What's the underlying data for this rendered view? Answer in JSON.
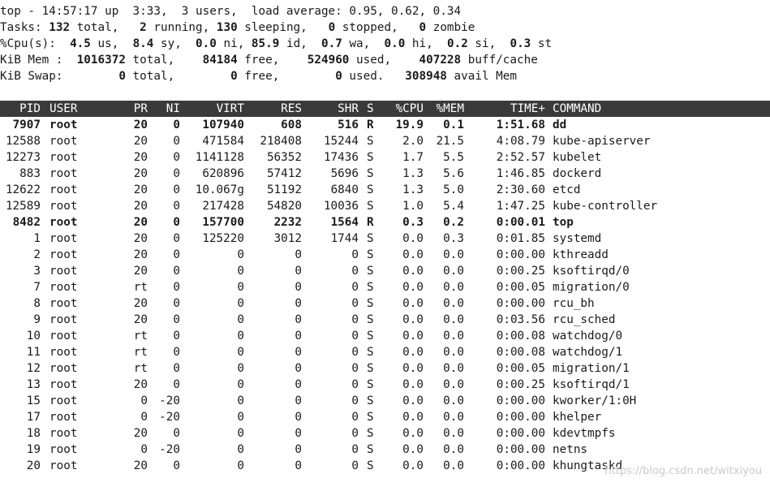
{
  "header": {
    "line1": [
      {
        "t": "top - 14:57:17 up  3:33,  3 users,  load average: 0.95, 0.62, 0.34",
        "b": false
      }
    ],
    "line2": [
      {
        "t": "Tasks: ",
        "b": false
      },
      {
        "t": "132",
        "b": true
      },
      {
        "t": " total,   ",
        "b": false
      },
      {
        "t": "2",
        "b": true
      },
      {
        "t": " running, ",
        "b": false
      },
      {
        "t": "130",
        "b": true
      },
      {
        "t": " sleeping,   ",
        "b": false
      },
      {
        "t": "0",
        "b": true
      },
      {
        "t": " stopped,   ",
        "b": false
      },
      {
        "t": "0",
        "b": true
      },
      {
        "t": " zombie",
        "b": false
      }
    ],
    "line3": [
      {
        "t": "%Cpu(s):  ",
        "b": false
      },
      {
        "t": "4.5",
        "b": true
      },
      {
        "t": " us,  ",
        "b": false
      },
      {
        "t": "8.4",
        "b": true
      },
      {
        "t": " sy,  ",
        "b": false
      },
      {
        "t": "0.0",
        "b": true
      },
      {
        "t": " ni, ",
        "b": false
      },
      {
        "t": "85.9",
        "b": true
      },
      {
        "t": " id,  ",
        "b": false
      },
      {
        "t": "0.7",
        "b": true
      },
      {
        "t": " wa,  ",
        "b": false
      },
      {
        "t": "0.0",
        "b": true
      },
      {
        "t": " hi,  ",
        "b": false
      },
      {
        "t": "0.2",
        "b": true
      },
      {
        "t": " si,  ",
        "b": false
      },
      {
        "t": "0.3",
        "b": true
      },
      {
        "t": " st",
        "b": false
      }
    ],
    "line4": [
      {
        "t": "KiB Mem :  ",
        "b": false
      },
      {
        "t": "1016372",
        "b": true
      },
      {
        "t": " total,    ",
        "b": false
      },
      {
        "t": "84184",
        "b": true
      },
      {
        "t": " free,    ",
        "b": false
      },
      {
        "t": "524960",
        "b": true
      },
      {
        "t": " used,    ",
        "b": false
      },
      {
        "t": "407228",
        "b": true
      },
      {
        "t": " buff/cache",
        "b": false
      }
    ],
    "line5": [
      {
        "t": "KiB Swap:        ",
        "b": false
      },
      {
        "t": "0",
        "b": true
      },
      {
        "t": " total,        ",
        "b": false
      },
      {
        "t": "0",
        "b": true
      },
      {
        "t": " free,        ",
        "b": false
      },
      {
        "t": "0",
        "b": true
      },
      {
        "t": " used.   ",
        "b": false
      },
      {
        "t": "308948",
        "b": true
      },
      {
        "t": " avail Mem",
        "b": false
      }
    ]
  },
  "columns": {
    "pid": "PID",
    "user": "USER",
    "pr": "PR",
    "ni": "NI",
    "virt": "VIRT",
    "res": "RES",
    "shr": "SHR",
    "s": "S",
    "cpu": "%CPU",
    "mem": "%MEM",
    "time": "TIME+",
    "cmd": "COMMAND"
  },
  "processes": [
    {
      "pid": "7907",
      "user": "root",
      "pr": "20",
      "ni": "0",
      "virt": "107940",
      "res": "608",
      "shr": "516",
      "s": "R",
      "cpu": "19.9",
      "mem": "0.1",
      "time": "1:51.68",
      "cmd": "dd",
      "running": true
    },
    {
      "pid": "12588",
      "user": "root",
      "pr": "20",
      "ni": "0",
      "virt": "471584",
      "res": "218408",
      "shr": "15244",
      "s": "S",
      "cpu": "2.0",
      "mem": "21.5",
      "time": "4:08.79",
      "cmd": "kube-apiserver",
      "running": false
    },
    {
      "pid": "12273",
      "user": "root",
      "pr": "20",
      "ni": "0",
      "virt": "1141128",
      "res": "56352",
      "shr": "17436",
      "s": "S",
      "cpu": "1.7",
      "mem": "5.5",
      "time": "2:52.57",
      "cmd": "kubelet",
      "running": false
    },
    {
      "pid": "883",
      "user": "root",
      "pr": "20",
      "ni": "0",
      "virt": "620896",
      "res": "57412",
      "shr": "5696",
      "s": "S",
      "cpu": "1.3",
      "mem": "5.6",
      "time": "1:46.85",
      "cmd": "dockerd",
      "running": false
    },
    {
      "pid": "12622",
      "user": "root",
      "pr": "20",
      "ni": "0",
      "virt": "10.067g",
      "res": "51192",
      "shr": "6840",
      "s": "S",
      "cpu": "1.3",
      "mem": "5.0",
      "time": "2:30.60",
      "cmd": "etcd",
      "running": false
    },
    {
      "pid": "12589",
      "user": "root",
      "pr": "20",
      "ni": "0",
      "virt": "217428",
      "res": "54820",
      "shr": "10036",
      "s": "S",
      "cpu": "1.0",
      "mem": "5.4",
      "time": "1:47.25",
      "cmd": "kube-controller",
      "running": false
    },
    {
      "pid": "8482",
      "user": "root",
      "pr": "20",
      "ni": "0",
      "virt": "157700",
      "res": "2232",
      "shr": "1564",
      "s": "R",
      "cpu": "0.3",
      "mem": "0.2",
      "time": "0:00.01",
      "cmd": "top",
      "running": true
    },
    {
      "pid": "1",
      "user": "root",
      "pr": "20",
      "ni": "0",
      "virt": "125220",
      "res": "3012",
      "shr": "1744",
      "s": "S",
      "cpu": "0.0",
      "mem": "0.3",
      "time": "0:01.85",
      "cmd": "systemd",
      "running": false
    },
    {
      "pid": "2",
      "user": "root",
      "pr": "20",
      "ni": "0",
      "virt": "0",
      "res": "0",
      "shr": "0",
      "s": "S",
      "cpu": "0.0",
      "mem": "0.0",
      "time": "0:00.00",
      "cmd": "kthreadd",
      "running": false
    },
    {
      "pid": "3",
      "user": "root",
      "pr": "20",
      "ni": "0",
      "virt": "0",
      "res": "0",
      "shr": "0",
      "s": "S",
      "cpu": "0.0",
      "mem": "0.0",
      "time": "0:00.25",
      "cmd": "ksoftirqd/0",
      "running": false
    },
    {
      "pid": "7",
      "user": "root",
      "pr": "rt",
      "ni": "0",
      "virt": "0",
      "res": "0",
      "shr": "0",
      "s": "S",
      "cpu": "0.0",
      "mem": "0.0",
      "time": "0:00.05",
      "cmd": "migration/0",
      "running": false
    },
    {
      "pid": "8",
      "user": "root",
      "pr": "20",
      "ni": "0",
      "virt": "0",
      "res": "0",
      "shr": "0",
      "s": "S",
      "cpu": "0.0",
      "mem": "0.0",
      "time": "0:00.00",
      "cmd": "rcu_bh",
      "running": false
    },
    {
      "pid": "9",
      "user": "root",
      "pr": "20",
      "ni": "0",
      "virt": "0",
      "res": "0",
      "shr": "0",
      "s": "S",
      "cpu": "0.0",
      "mem": "0.0",
      "time": "0:03.56",
      "cmd": "rcu_sched",
      "running": false
    },
    {
      "pid": "10",
      "user": "root",
      "pr": "rt",
      "ni": "0",
      "virt": "0",
      "res": "0",
      "shr": "0",
      "s": "S",
      "cpu": "0.0",
      "mem": "0.0",
      "time": "0:00.08",
      "cmd": "watchdog/0",
      "running": false
    },
    {
      "pid": "11",
      "user": "root",
      "pr": "rt",
      "ni": "0",
      "virt": "0",
      "res": "0",
      "shr": "0",
      "s": "S",
      "cpu": "0.0",
      "mem": "0.0",
      "time": "0:00.08",
      "cmd": "watchdog/1",
      "running": false
    },
    {
      "pid": "12",
      "user": "root",
      "pr": "rt",
      "ni": "0",
      "virt": "0",
      "res": "0",
      "shr": "0",
      "s": "S",
      "cpu": "0.0",
      "mem": "0.0",
      "time": "0:00.05",
      "cmd": "migration/1",
      "running": false
    },
    {
      "pid": "13",
      "user": "root",
      "pr": "20",
      "ni": "0",
      "virt": "0",
      "res": "0",
      "shr": "0",
      "s": "S",
      "cpu": "0.0",
      "mem": "0.0",
      "time": "0:00.25",
      "cmd": "ksoftirqd/1",
      "running": false
    },
    {
      "pid": "15",
      "user": "root",
      "pr": "0",
      "ni": "-20",
      "virt": "0",
      "res": "0",
      "shr": "0",
      "s": "S",
      "cpu": "0.0",
      "mem": "0.0",
      "time": "0:00.00",
      "cmd": "kworker/1:0H",
      "running": false
    },
    {
      "pid": "17",
      "user": "root",
      "pr": "0",
      "ni": "-20",
      "virt": "0",
      "res": "0",
      "shr": "0",
      "s": "S",
      "cpu": "0.0",
      "mem": "0.0",
      "time": "0:00.00",
      "cmd": "khelper",
      "running": false
    },
    {
      "pid": "18",
      "user": "root",
      "pr": "20",
      "ni": "0",
      "virt": "0",
      "res": "0",
      "shr": "0",
      "s": "S",
      "cpu": "0.0",
      "mem": "0.0",
      "time": "0:00.00",
      "cmd": "kdevtmpfs",
      "running": false
    },
    {
      "pid": "19",
      "user": "root",
      "pr": "0",
      "ni": "-20",
      "virt": "0",
      "res": "0",
      "shr": "0",
      "s": "S",
      "cpu": "0.0",
      "mem": "0.0",
      "time": "0:00.00",
      "cmd": "netns",
      "running": false
    },
    {
      "pid": "20",
      "user": "root",
      "pr": "20",
      "ni": "0",
      "virt": "0",
      "res": "0",
      "shr": "0",
      "s": "S",
      "cpu": "0.0",
      "mem": "0.0",
      "time": "0:00.00",
      "cmd": "khungtaskd",
      "running": false
    }
  ],
  "watermark": "https://blog.csdn.net/witxiyou",
  "colors": {
    "header_bg": "#3a3a3a",
    "header_fg": "#ffffff",
    "text": "#1a1a1a",
    "background": "#ffffff"
  }
}
